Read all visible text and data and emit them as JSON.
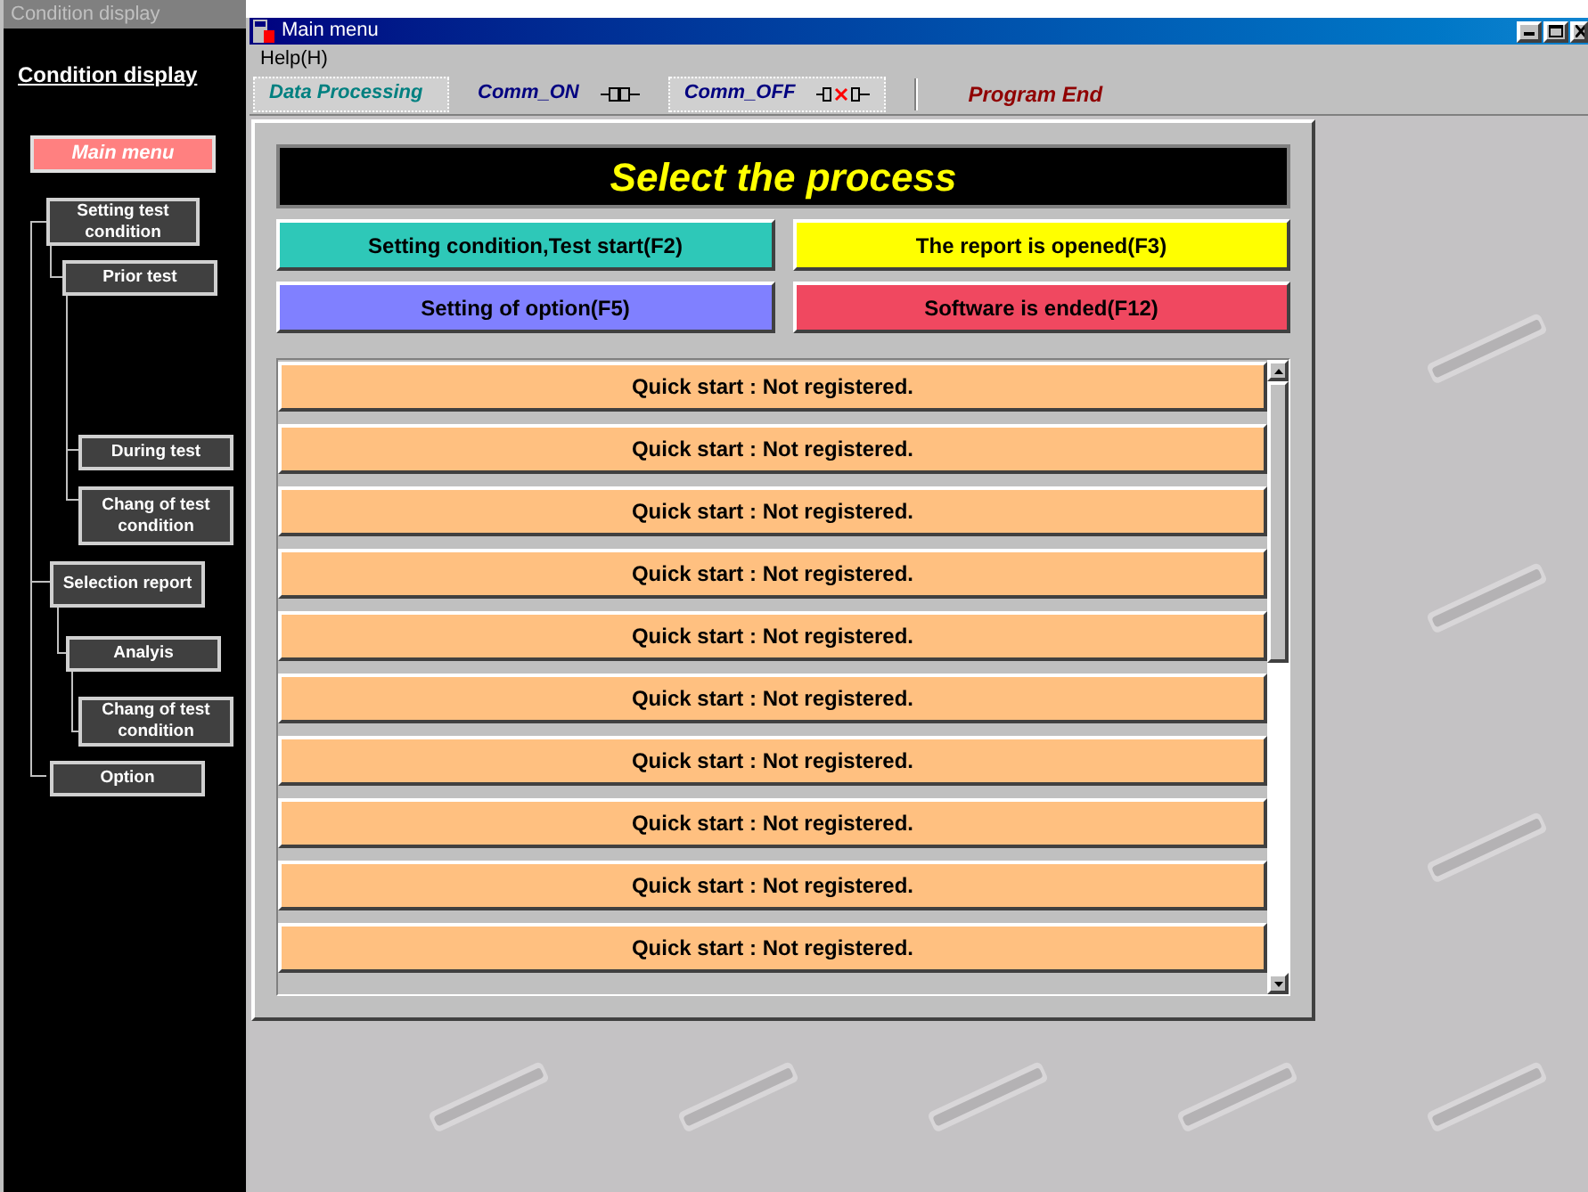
{
  "side_panel": {
    "title": "Condition display",
    "heading": "Condition display",
    "main_menu": "Main menu",
    "tree": [
      {
        "label": "Setting test condition",
        "children": [
          {
            "label": "Prior test",
            "children": [
              {
                "label": "During test"
              },
              {
                "label": "Chang of test condition"
              }
            ]
          }
        ]
      },
      {
        "label": "Selection report",
        "children": [
          {
            "label": "Analyis",
            "children": [
              {
                "label": "Chang of test condition"
              }
            ]
          }
        ]
      },
      {
        "label": "Option"
      }
    ]
  },
  "window": {
    "title": "Main menu",
    "menu": [
      "Help(H)"
    ]
  },
  "toolbar": [
    {
      "kind": "mode",
      "label": "Data Processing",
      "selected": true
    },
    {
      "kind": "comm_on",
      "label": "Comm_ON",
      "selected": false
    },
    {
      "kind": "comm_off",
      "label": "Comm_OFF",
      "selected": true
    },
    {
      "kind": "end",
      "label": "Program End",
      "selected": false
    }
  ],
  "panel": {
    "title": "Select the process",
    "buttons": [
      {
        "label": "Setting condition,Test start(F2)",
        "color": "#2ec8b8"
      },
      {
        "label": "The report is opened(F3)",
        "color": "#ffff00"
      },
      {
        "label": "Setting of option(F5)",
        "color": "#8080ff"
      },
      {
        "label": "Software is ended(F12)",
        "color": "#f04860"
      }
    ],
    "quick_starts": [
      "Quick start : Not registered.",
      "Quick start : Not registered.",
      "Quick start : Not registered.",
      "Quick start : Not registered.",
      "Quick start : Not registered.",
      "Quick start : Not registered.",
      "Quick start : Not registered.",
      "Quick start : Not registered.",
      "Quick start : Not registered.",
      "Quick start : Not registered."
    ]
  }
}
